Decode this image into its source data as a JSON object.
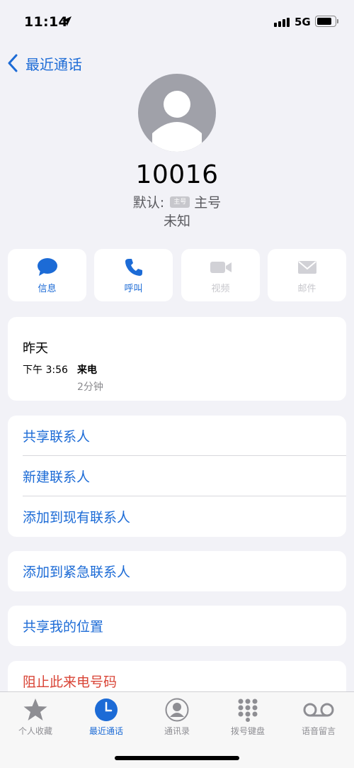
{
  "status": {
    "time": "11:14",
    "network": "5G"
  },
  "nav": {
    "back_label": "最近通话"
  },
  "contact": {
    "number": "10016",
    "default_label": "默认:",
    "badge": "主号",
    "line_label": "主号",
    "location": "未知"
  },
  "actions": [
    {
      "label": "信息",
      "icon": "message-icon",
      "enabled": true
    },
    {
      "label": "呼叫",
      "icon": "phone-icon",
      "enabled": true
    },
    {
      "label": "视频",
      "icon": "video-icon",
      "enabled": false
    },
    {
      "label": "邮件",
      "icon": "mail-icon",
      "enabled": false
    }
  ],
  "recent_call": {
    "day": "昨天",
    "time": "下午 3:56",
    "type": "来电",
    "duration": "2分钟"
  },
  "options": {
    "share_contact": "共享联系人",
    "create_contact": "新建联系人",
    "add_existing": "添加到现有联系人",
    "add_emergency": "添加到紧急联系人",
    "share_location": "共享我的位置",
    "block_caller": "阻止此来电号码"
  },
  "tabs": [
    {
      "label": "个人收藏",
      "icon": "star-icon"
    },
    {
      "label": "最近通话",
      "icon": "clock-icon",
      "active": true
    },
    {
      "label": "通讯录",
      "icon": "person-circle-icon"
    },
    {
      "label": "拨号键盘",
      "icon": "keypad-icon"
    },
    {
      "label": "语音留言",
      "icon": "voicemail-icon"
    }
  ],
  "colors": {
    "accent": "#1c6bd6",
    "danger": "#d94436",
    "background": "#f2f2f7"
  }
}
